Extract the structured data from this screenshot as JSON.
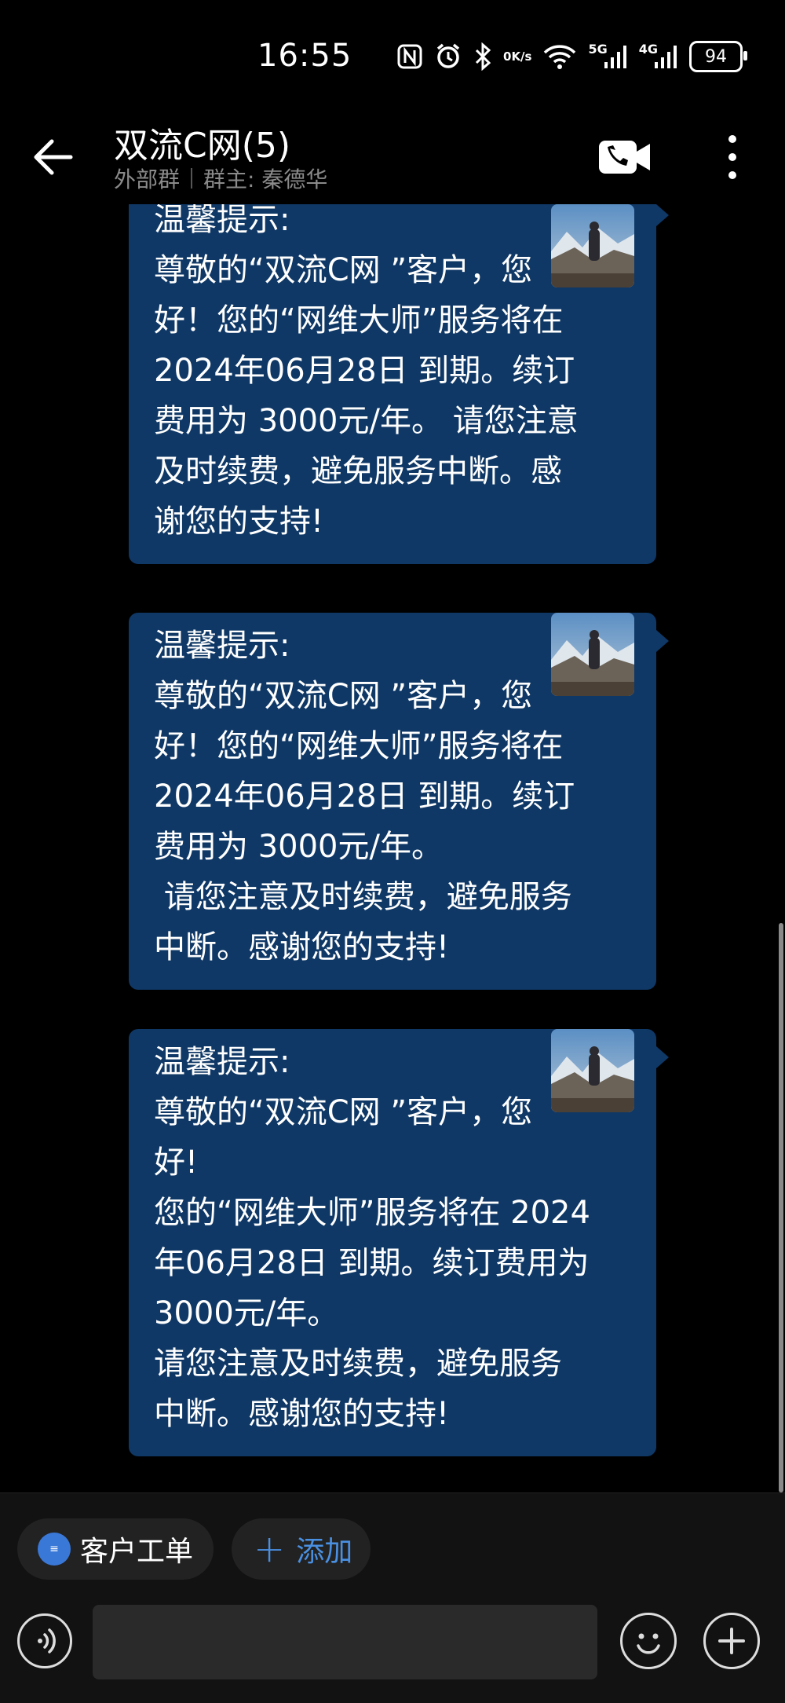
{
  "status_bar": {
    "time": "16:55",
    "network_speed_value": "0",
    "network_speed_unit": "K/s",
    "net1": "5G",
    "net2": "4G",
    "battery": "94"
  },
  "header": {
    "title": "双流C网(5)",
    "subtitle_type": "外部群",
    "subtitle_owner": "群主: 秦德华"
  },
  "messages": [
    {
      "text": "温馨提示:\n尊敬的“双流C网 ”客户，您\n好！您的“网维大师”服务将在\n2024年06月28日 到期。续订\n费用为 3000元/年。 请您注意\n及时续费，避免服务中断。感\n谢您的支持!"
    },
    {
      "text": "温馨提示:\n尊敬的“双流C网 ”客户，您\n好！您的“网维大师”服务将在\n2024年06月28日 到期。续订\n费用为 3000元/年。\n 请您注意及时续费，避免服务\n中断。感谢您的支持!"
    },
    {
      "text": "温馨提示:\n尊敬的“双流C网 ”客户，您\n好!\n您的“网维大师”服务将在 2024\n年06月28日 到期。续订费用为\n3000元/年。\n请您注意及时续费，避免服务\n中断。感谢您的支持!"
    }
  ],
  "quick_actions": {
    "ticket_label": "客户工单",
    "add_label": "添加"
  },
  "colors": {
    "bubble": "#0f3866",
    "accent": "#4a90e2"
  }
}
